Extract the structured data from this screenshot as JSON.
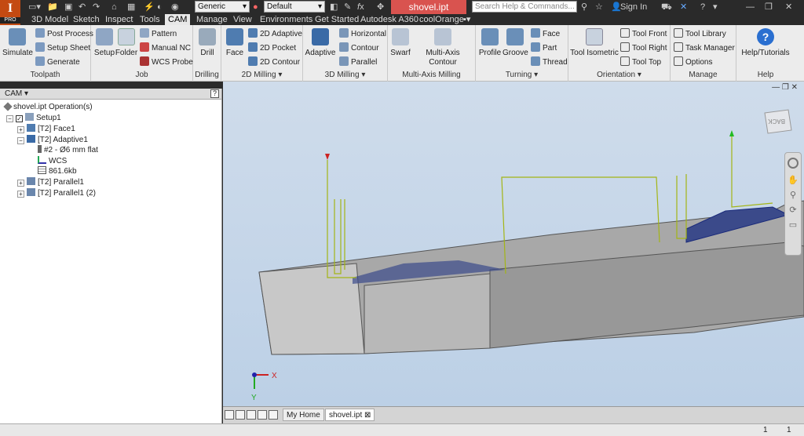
{
  "qat": {
    "appearance": "Generic",
    "style": "Default",
    "search_placeholder": "Search Help & Commands...",
    "sign_in": "Sign In",
    "pro": "PRO"
  },
  "file_tab": "shovel.ipt",
  "menu": [
    "3D Model",
    "Sketch",
    "Inspect",
    "Tools",
    "CAM",
    "Manage",
    "View",
    "Environments",
    "Get Started",
    "Autodesk A360",
    "coolOrange"
  ],
  "ribbon": {
    "toolpath": {
      "label": "Toolpath",
      "simulate": "Simulate",
      "post": "Post Process",
      "setup_sheet": "Setup Sheet",
      "generate": "Generate"
    },
    "job": {
      "label": "Job",
      "setup": "Setup",
      "folder": "Folder",
      "pattern": "Pattern",
      "manual_nc": "Manual NC",
      "wcs_probe": "WCS Probe"
    },
    "drilling": {
      "label": "Drilling",
      "drill": "Drill"
    },
    "m2d": {
      "label": "2D Milling",
      "face": "Face",
      "adaptive": "2D Adaptive",
      "pocket": "2D Pocket",
      "contour": "2D Contour"
    },
    "m3d": {
      "label": "3D Milling",
      "adaptive": "Adaptive",
      "horizontal": "Horizontal",
      "contour": "Contour",
      "parallel": "Parallel"
    },
    "multi": {
      "label": "Multi-Axis Milling",
      "swarf": "Swarf",
      "multi_contour": "Multi-Axis Contour"
    },
    "turning": {
      "label": "Turning",
      "profile": "Profile",
      "groove": "Groove",
      "face": "Face",
      "part": "Part",
      "thread": "Thread"
    },
    "orientation": {
      "label": "Orientation",
      "iso": "Tool Isometric",
      "front": "Tool Front",
      "right": "Tool Right",
      "top": "Tool Top"
    },
    "manage": {
      "label": "Manage",
      "library": "Tool Library",
      "task": "Task Manager",
      "options": "Options"
    },
    "help": {
      "label": "Help",
      "tutorials": "Help/Tutorials"
    }
  },
  "panel": {
    "title": "CAM",
    "root": "shovel.ipt Operation(s)",
    "setup": "Setup1",
    "face": "[T2] Face1",
    "adaptive": "[T2] Adaptive1",
    "tool": "#2 - Ø6 mm flat",
    "wcs": "WCS",
    "size": "861.6kb",
    "parallel": "[T2] Parallel1",
    "parallel2": "[T2] Parallel1 (2)"
  },
  "viewcube": "BACK",
  "axes": {
    "x": "X",
    "y": "Y"
  },
  "tabs": {
    "home": "My Home",
    "file": "shovel.ipt"
  },
  "status": {
    "a": "1",
    "b": "1"
  },
  "colors": {
    "accent": "#c44a12",
    "file_tab": "#d9534f",
    "viewport": "#c5d6e8",
    "toolpath": "#a3b515",
    "toolpath_dense": "#1a2a7a"
  }
}
